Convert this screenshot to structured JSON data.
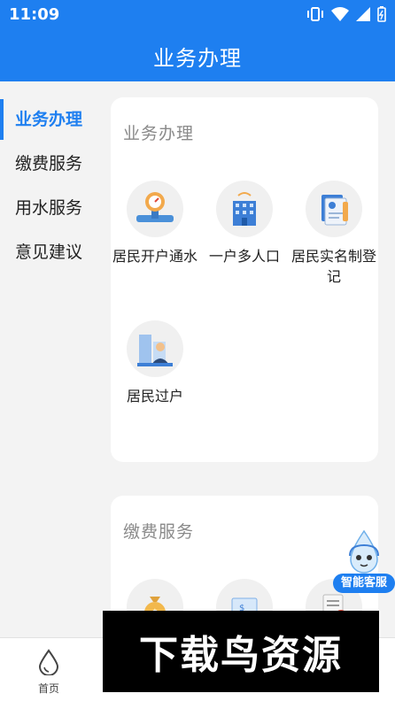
{
  "status_bar": {
    "time": "11:09"
  },
  "header": {
    "title": "业务办理"
  },
  "sidebar": {
    "items": [
      {
        "label": "业务办理",
        "active": true
      },
      {
        "label": "缴费服务",
        "active": false
      },
      {
        "label": "用水服务",
        "active": false
      },
      {
        "label": "意见建议",
        "active": false
      }
    ]
  },
  "sections": [
    {
      "title": "业务办理",
      "items": [
        {
          "label": "居民开户通水",
          "icon": "water-meter-icon"
        },
        {
          "label": "一户多人口",
          "icon": "building-icon"
        },
        {
          "label": "居民实名制登记",
          "icon": "id-registration-icon"
        },
        {
          "label": "居民过户",
          "icon": "person-transfer-icon"
        }
      ]
    },
    {
      "title": "缴费服务",
      "items": [
        {
          "label": "",
          "icon": "money-bag-icon"
        },
        {
          "label": "",
          "icon": "bill-icon"
        },
        {
          "label": "",
          "icon": "invoice-icon"
        }
      ]
    }
  ],
  "floating_service": {
    "label": "智能客服",
    "icon": "water-drop-mascot-icon"
  },
  "bottom_nav": {
    "home_label": "首页",
    "icon": "water-drop-icon"
  },
  "watermark": {
    "text": "下载鸟资源"
  },
  "colors": {
    "primary": "#1e7ff0",
    "background": "#f3f3f3"
  }
}
